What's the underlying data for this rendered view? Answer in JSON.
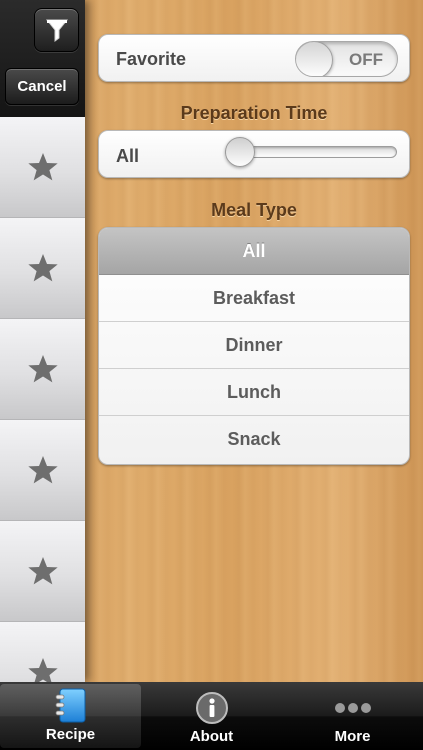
{
  "panel": {
    "cancel_label": "Cancel",
    "star_rows": 6
  },
  "filters": {
    "favorite": {
      "label": "Favorite",
      "state": "OFF"
    },
    "preparation_time": {
      "title": "Preparation Time",
      "value": "All",
      "slider_fraction": 0.0
    },
    "meal_type": {
      "title": "Meal Type",
      "items": [
        {
          "label": "All",
          "selected": true
        },
        {
          "label": "Breakfast",
          "selected": false
        },
        {
          "label": "Dinner",
          "selected": false
        },
        {
          "label": "Lunch",
          "selected": false
        },
        {
          "label": "Snack",
          "selected": false
        }
      ]
    }
  },
  "tabs": [
    {
      "label": "Recipe",
      "icon": "recipe-book-icon",
      "active": true
    },
    {
      "label": "About",
      "icon": "info-icon",
      "active": false
    },
    {
      "label": "More",
      "icon": "ellipsis-icon",
      "active": false
    }
  ]
}
